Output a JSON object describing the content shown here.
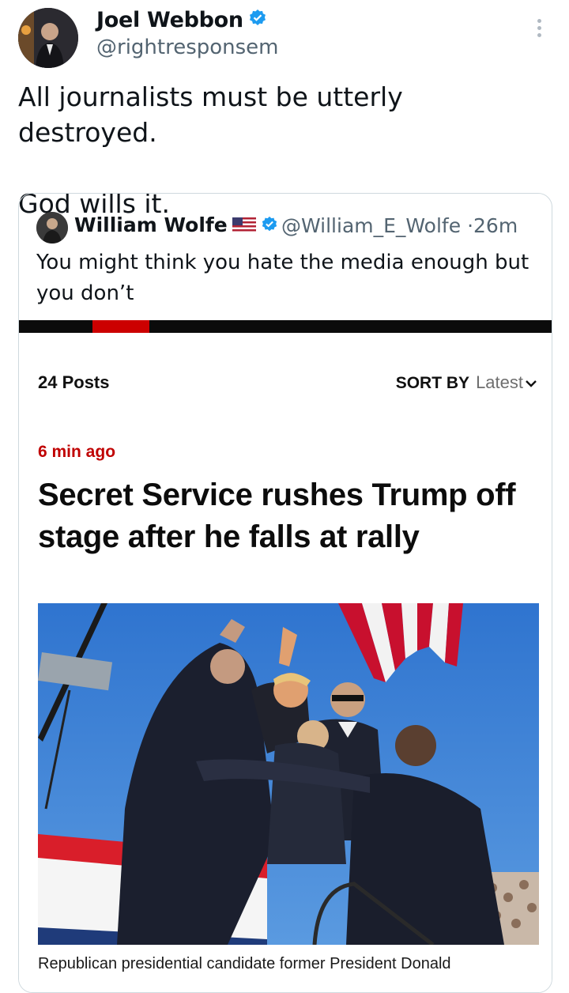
{
  "tweet": {
    "author_name": "Joel Webbon",
    "author_handle": "@rightresponsem",
    "text": "All journalists must be utterly destroyed.\n\nGod wills it."
  },
  "quoted_tweet": {
    "author_name": "William Wolfe",
    "author_handle": "@William_E_Wolfe",
    "time": "26m",
    "meta_separator": "·",
    "text": "You might think you hate the media enough but you don’t",
    "flag_icon": "us-flag-icon"
  },
  "embedded_article": {
    "posts_count": "24 Posts",
    "sort_by_label": "SORT BY",
    "sort_by_value": "Latest",
    "time_ago": "6 min ago",
    "headline": "Secret Service rushes Trump off stage after he falls at rally",
    "caption": "Republican presidential candidate former President Donald"
  },
  "colors": {
    "verified_blue": "#1d9bf0",
    "handle_gray": "#536471",
    "accent_red": "#cc0000",
    "sky_blue": "#3b7fd4"
  }
}
